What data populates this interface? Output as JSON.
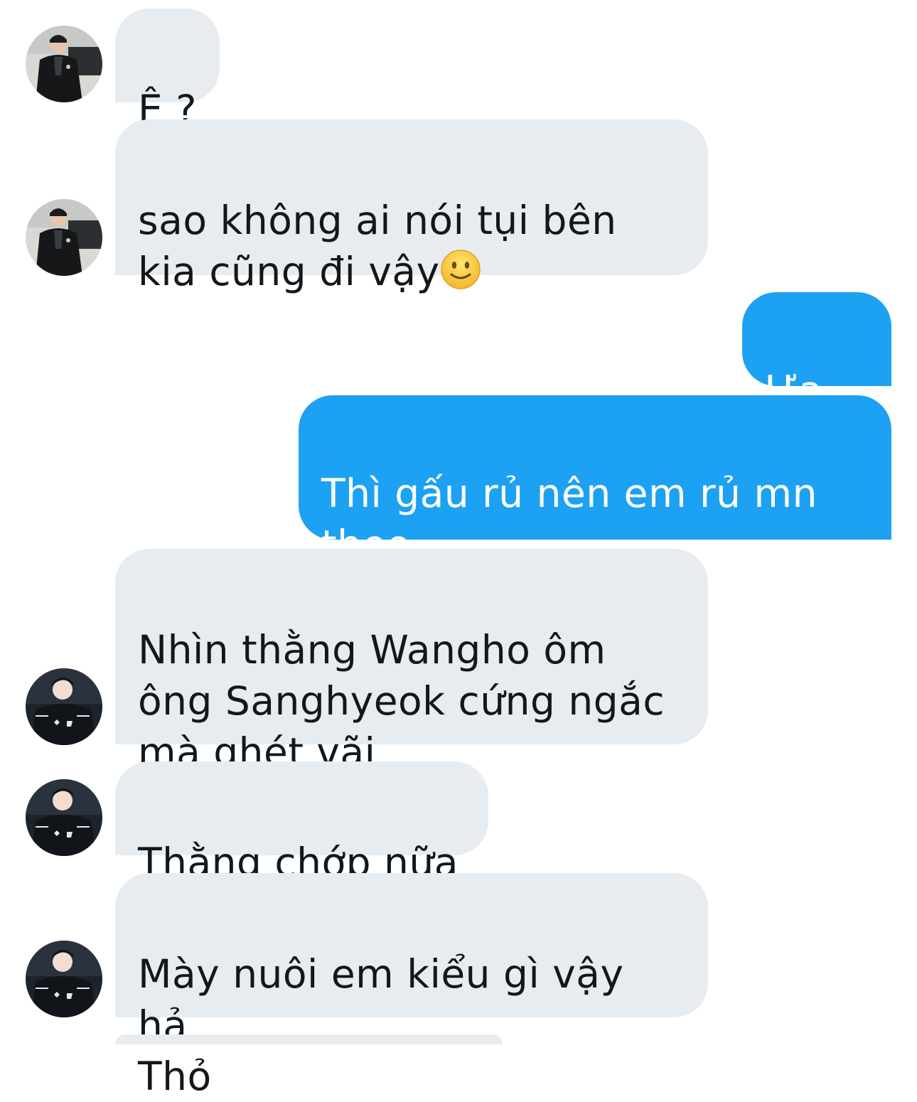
{
  "colors": {
    "incoming_bubble": "#e6ecf0",
    "outgoing_bubble": "#1da1f2",
    "incoming_text": "#14171a",
    "outgoing_text": "#ffffff"
  },
  "conversation": {
    "messages": [
      {
        "sender": "other-1",
        "text": "Ê ?"
      },
      {
        "sender": "other-1",
        "text": "sao không ai nói tụi bên\nkia cũng đi vậy",
        "emoji": "slightly-smiling-face-icon"
      },
      {
        "sender": "me",
        "text": "Ựa ..."
      },
      {
        "sender": "me",
        "text": "Thì gấu rủ nên em rủ mn\ntheo"
      },
      {
        "sender": "other-2",
        "text": "Nhìn thằng Wangho ôm\nông Sanghyeok cứng ngắc\nmà ghét vãi"
      },
      {
        "sender": "other-2",
        "text": "Thằng chớp nữa"
      },
      {
        "sender": "other-2",
        "text": "Mày nuôi em kiểu gì vậy hả\nThỏ"
      }
    ]
  }
}
